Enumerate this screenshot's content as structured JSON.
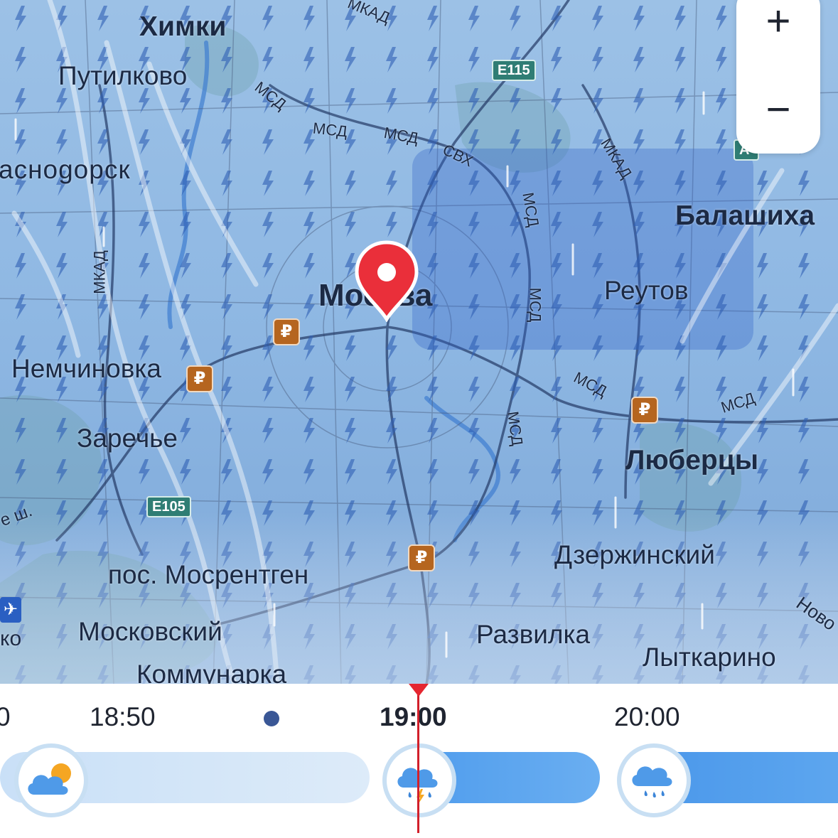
{
  "map": {
    "places": {
      "khimki": "Химки",
      "putilkovo": "Путилково",
      "krasnogorsk": "аснogорск",
      "moskva": "Москва",
      "balashikha": "Балашиха",
      "reutov": "Реутов",
      "nemchinovka": "Немчиновка",
      "zarechye": "Заречье",
      "lyubertsy": "Люберцы",
      "dzerzhinsky": "Дзержинский",
      "mosrentgen": "пос. Мосрентген",
      "moskovsky": "Московский",
      "razvilka": "Развилка",
      "lytkarino": "Лыткарино",
      "kommunarka": "Коммунарка",
      "novo": "Ново",
      "vnukovo_frag": "ко",
      "roadfrag": "е ш."
    },
    "roads": {
      "mkad": "МКАД",
      "msd": "МСД",
      "svh": "СВХ"
    },
    "shields": {
      "e115": "E115",
      "e105": "E105",
      "a_partial": "A"
    },
    "poi_symbol": "₽",
    "airport_symbol": "✈"
  },
  "zoom": {
    "plus": "+",
    "minus": "−"
  },
  "timeline": {
    "labels": {
      "left_partial": "0",
      "t1": "18:50",
      "t2": "19:00",
      "t3": "20:00"
    },
    "icons": {
      "first": "partly-cloudy-icon",
      "second": "thunderstorm-rain-icon",
      "third": "rain-icon"
    },
    "colors": {
      "accent": "#e52630",
      "bar_light": "#cfe3f7",
      "bar_dark": "#4b98ea"
    }
  }
}
